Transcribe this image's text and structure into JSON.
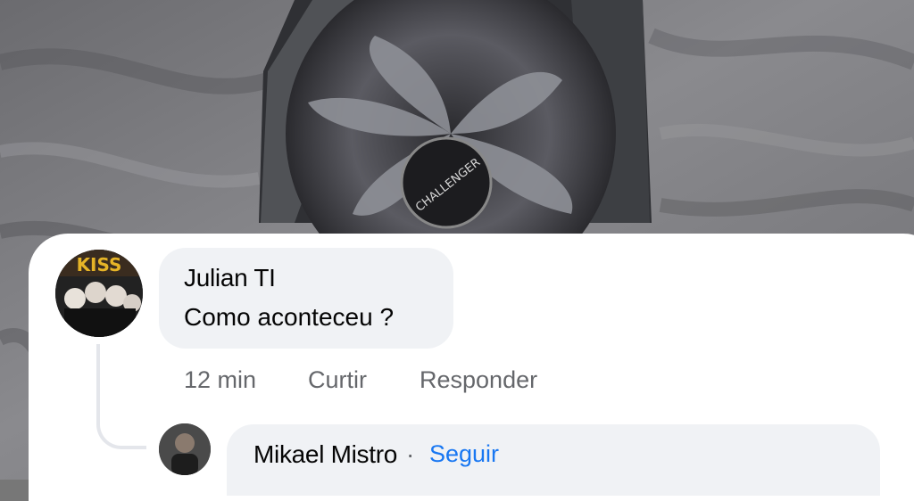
{
  "comment": {
    "author": "Julian TI",
    "text": "Como aconteceu ?",
    "actions": {
      "time": "12 min",
      "like": "Curtir",
      "reply": "Responder"
    },
    "avatar_badge": "KISS"
  },
  "reply": {
    "author": "Mikael Mistro",
    "separator": "·",
    "follow": "Seguir"
  },
  "photo": {
    "fan_hub_label": "CHALLENGER"
  },
  "colors": {
    "link": "#1877f2",
    "muted": "#65676b",
    "bubble": "#f0f2f5"
  }
}
